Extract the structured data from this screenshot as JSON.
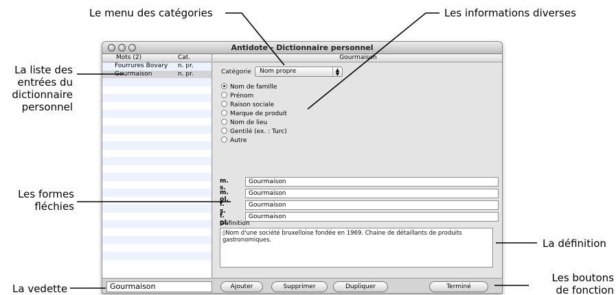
{
  "callouts": {
    "categories_menu": "Le menu des catégories",
    "misc_info": "Les informations diverses",
    "entries_list": [
      "La liste des",
      "entrées du",
      "dictionnaire",
      "personnel"
    ],
    "inflected_forms": [
      "Les formes",
      "fléchies"
    ],
    "definition": "La définition",
    "headword": "La vedette",
    "function_buttons": [
      "Les boutons",
      "de fonction"
    ]
  },
  "window": {
    "title": "Antidote - Dictionnaire personnel"
  },
  "list": {
    "columns": [
      "Mots (2)",
      "Cat."
    ],
    "rows": [
      {
        "word": "Fourrures Bovary",
        "cat": "n. pr.",
        "selected": false
      },
      {
        "word": "Gourmaison",
        "cat": "n. pr.",
        "selected": true
      }
    ]
  },
  "detail": {
    "header": "Gourmaison",
    "category_label": "Catégorie",
    "category_value": "Nom propre",
    "subtypes": [
      {
        "label": "Nom de famille",
        "selected": true
      },
      {
        "label": "Prénom",
        "selected": false
      },
      {
        "label": "Raison sociale",
        "selected": false
      },
      {
        "label": "Marque de produit",
        "selected": false
      },
      {
        "label": "Nom de lieu",
        "selected": false
      },
      {
        "label": "Gentilé (ex. : Turc)",
        "selected": false
      },
      {
        "label": "Autre",
        "selected": false
      }
    ],
    "forms": [
      {
        "label": "m. s.",
        "value": "Gourmaison"
      },
      {
        "label": "m. pl.",
        "value": "Gourmaison"
      },
      {
        "label": "f. s.",
        "value": "Gourmaison"
      },
      {
        "label": "f. pl.",
        "value": "Gourmaison"
      }
    ],
    "definition_label": "Définition",
    "definition_text": "◊Nom d'une société bruxelloise fondée en 1969. Chaine de détaillants de produits gastronomiques."
  },
  "bottom": {
    "headword_value": "Gourmaison",
    "buttons": {
      "add": "Ajouter",
      "delete": "Supprimer",
      "duplicate": "Dupliquer",
      "done": "Terminé"
    }
  }
}
